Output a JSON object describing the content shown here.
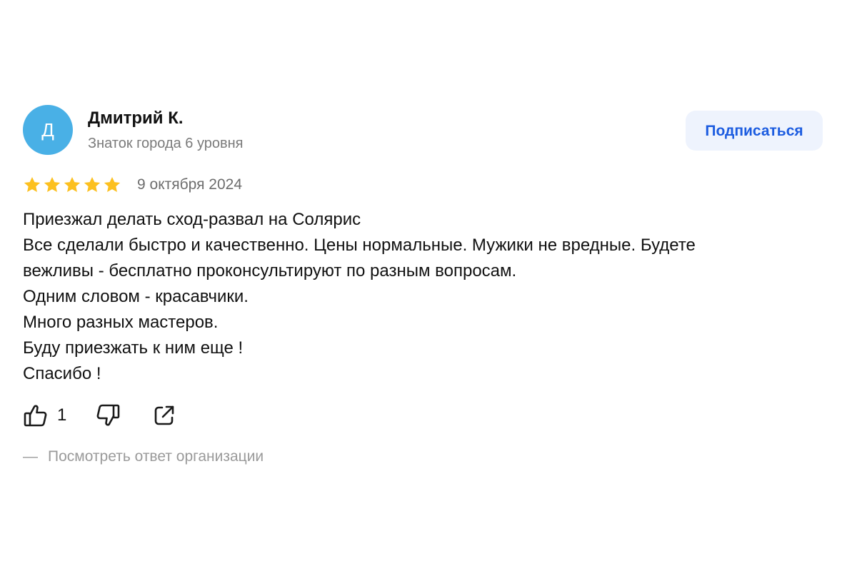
{
  "author": {
    "avatar_letter": "Д",
    "avatar_color": "#49b0e6",
    "name": "Дмитрий К.",
    "level": "Знаток города 6 уровня"
  },
  "subscribe_label": "Подписаться",
  "review": {
    "rating": 5,
    "max_rating": 5,
    "star_color": "#fcc020",
    "date": "9 октября 2024",
    "lines": [
      "Приезжал делать сход-развал на Солярис",
      "Все сделали быстро и качественно. Цены нормальные. Мужики не вредные. Будете",
      "вежливы - бесплатно проконсультируют по разным вопросам.",
      "Одним словом - красавчики.",
      "Много разных мастеров.",
      "Буду приезжать к ним еще !",
      "Спасибо !"
    ]
  },
  "actions": {
    "like_icon": "thumbs-up-icon",
    "like_count": "1",
    "dislike_icon": "thumbs-down-icon",
    "share_icon": "share-icon"
  },
  "org_reply": {
    "dash": "—",
    "label": "Посмотреть ответ организации"
  }
}
